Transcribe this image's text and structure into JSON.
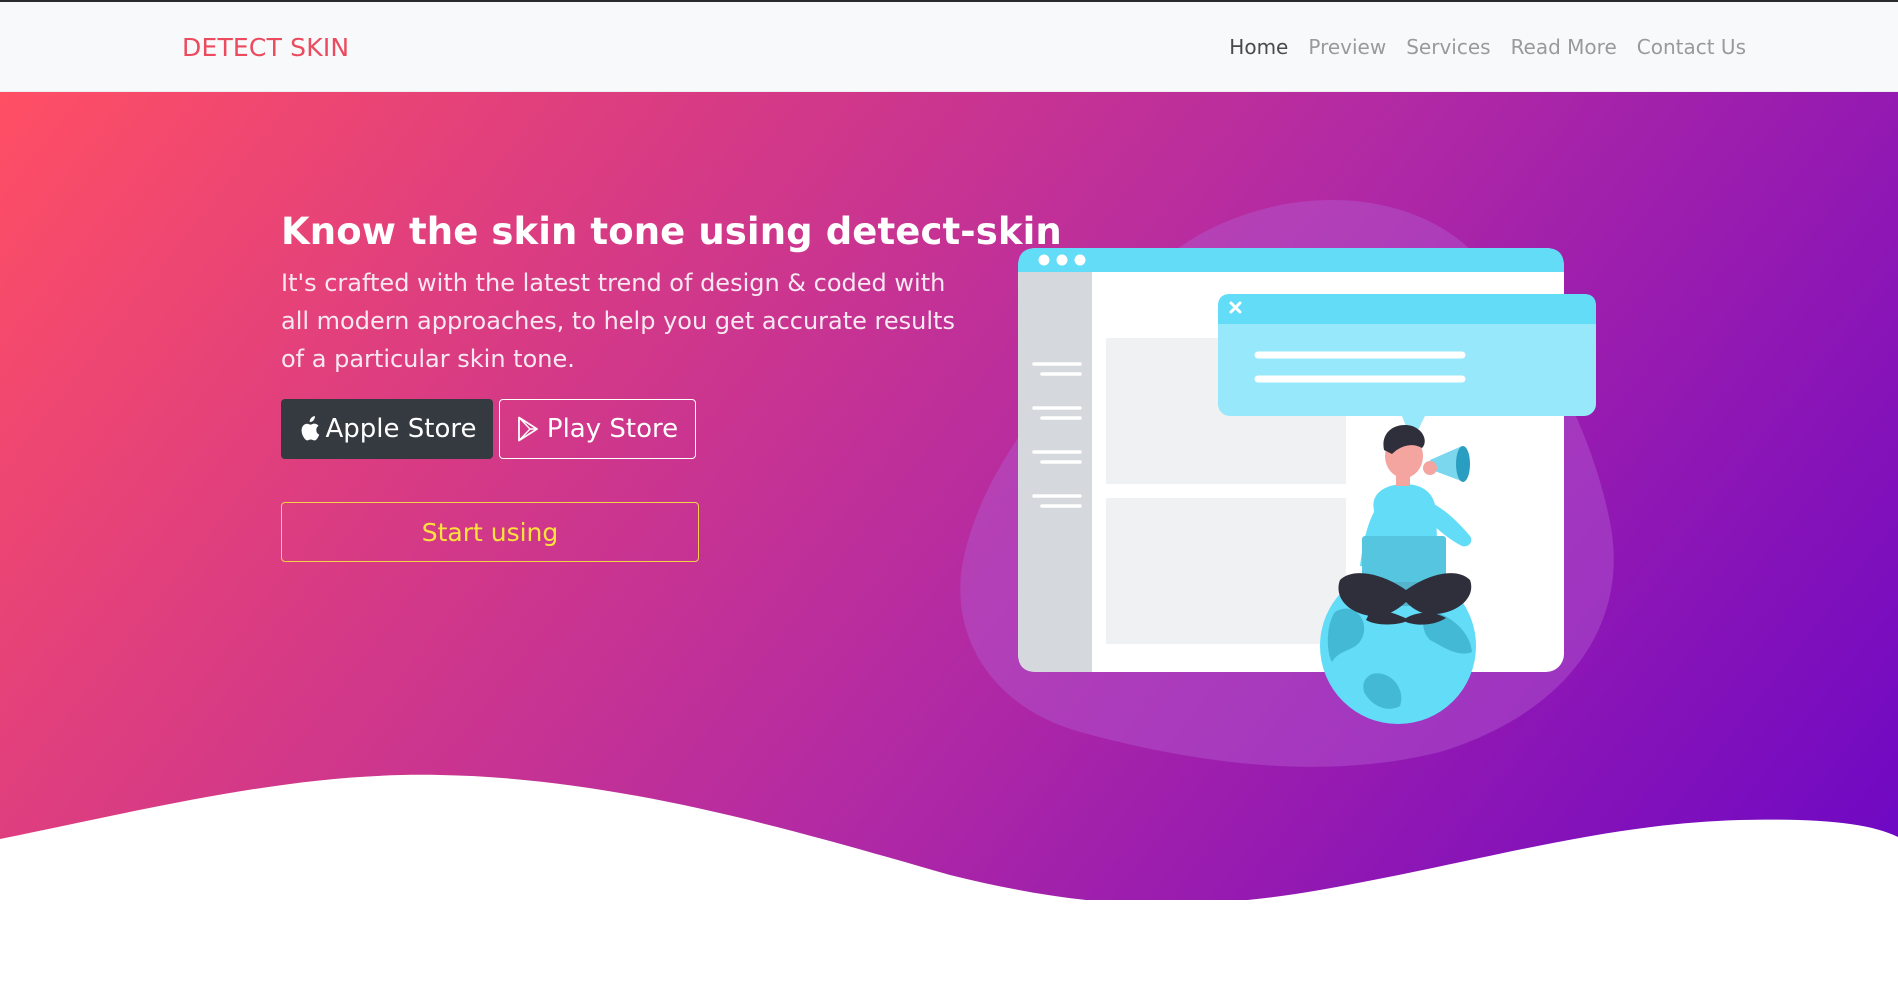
{
  "brand": {
    "name": "DETECT SKIN"
  },
  "nav": {
    "items": [
      {
        "label": "Home",
        "active": true
      },
      {
        "label": "Preview",
        "active": false
      },
      {
        "label": "Services",
        "active": false
      },
      {
        "label": "Read More",
        "active": false
      },
      {
        "label": "Contact Us",
        "active": false
      }
    ]
  },
  "hero": {
    "title": "Know the skin tone using detect-skin",
    "subtitle": "It's crafted with the latest trend of design & coded with all modern approaches, to help you get accurate results of a particular skin tone.",
    "apple_button": "Apple Store",
    "play_button": "Play Store",
    "start_button": "Start using"
  },
  "icons": {
    "apple": "apple-icon",
    "play": "play-store-icon",
    "close": "close-icon"
  },
  "colors": {
    "brand": "#ec4a5e",
    "gradient_start": "#ff4f64",
    "gradient_end": "#6c07c5",
    "start_button": "#ffe23b",
    "dark_button": "#343a40"
  }
}
